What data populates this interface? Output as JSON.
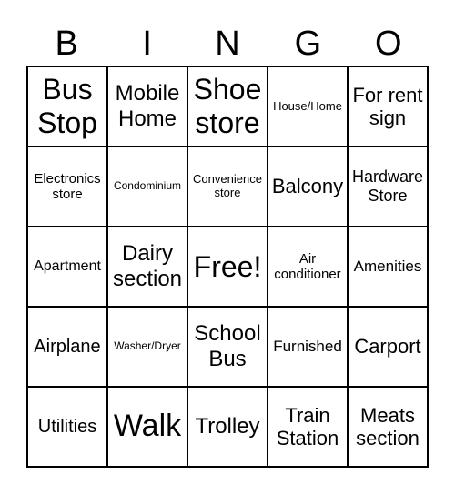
{
  "header": [
    "B",
    "I",
    "N",
    "G",
    "O"
  ],
  "cells": [
    "Bus Stop",
    "Mobile Home",
    "Shoe store",
    "House/Home",
    "For rent sign",
    "Electronics store",
    "Condominium",
    "Convenience store",
    "Balcony",
    "Hardware Store",
    "Apartment",
    "Dairy section",
    "Free!",
    "Air conditioner",
    "Amenities",
    "Airplane",
    "Washer/Dryer",
    "School Bus",
    "Furnished",
    "Carport",
    "Utilities",
    "Walk",
    "Trolley",
    "Train Station",
    "Meats section"
  ]
}
